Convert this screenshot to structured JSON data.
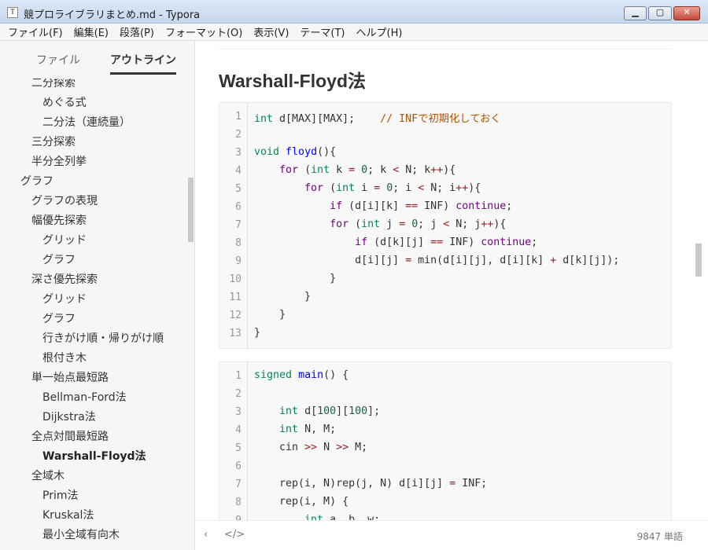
{
  "window": {
    "title": "競プロライブラリまとめ.md - Typora",
    "app_icon": "T"
  },
  "menu": [
    "ファイル(F)",
    "編集(E)",
    "段落(P)",
    "フォーマット(O)",
    "表示(V)",
    "テーマ(T)",
    "ヘルプ(H)"
  ],
  "sidebar": {
    "tabs": {
      "files": "ファイル",
      "outline": "アウトライン"
    },
    "outline": [
      {
        "label": "二分探索",
        "level": 2
      },
      {
        "label": "めぐる式",
        "level": 3
      },
      {
        "label": "二分法（連続量）",
        "level": 3
      },
      {
        "label": "三分探索",
        "level": 2
      },
      {
        "label": "半分全列挙",
        "level": 2
      },
      {
        "label": "グラフ",
        "level": 1
      },
      {
        "label": "グラフの表現",
        "level": 2
      },
      {
        "label": "幅優先探索",
        "level": 2
      },
      {
        "label": "グリッド",
        "level": 3
      },
      {
        "label": "グラフ",
        "level": 3
      },
      {
        "label": "深さ優先探索",
        "level": 2
      },
      {
        "label": "グリッド",
        "level": 3
      },
      {
        "label": "グラフ",
        "level": 3
      },
      {
        "label": "行きがけ順・帰りがけ順",
        "level": 3
      },
      {
        "label": "根付き木",
        "level": 3
      },
      {
        "label": "単一始点最短路",
        "level": 2
      },
      {
        "label": "Bellman-Ford法",
        "level": 3
      },
      {
        "label": "Dijkstra法",
        "level": 3
      },
      {
        "label": "全点対間最短路",
        "level": 2
      },
      {
        "label": "Warshall-Floyd法",
        "level": 3,
        "active": true
      },
      {
        "label": "全域木",
        "level": 2
      },
      {
        "label": "Prim法",
        "level": 3
      },
      {
        "label": "Kruskal法",
        "level": 3
      },
      {
        "label": "最小全域有向木",
        "level": 3
      }
    ]
  },
  "editor": {
    "heading": "Warshall-Floyd法",
    "code_blocks": [
      {
        "line_numbers": [
          "1",
          "2",
          "3",
          "4",
          "5",
          "6",
          "7",
          "8",
          "9",
          "10",
          "11",
          "12",
          "13"
        ],
        "lines": [
          [
            [
              "int",
              "ty"
            ],
            [
              " d[MAX][MAX];    ",
              ""
            ],
            [
              "// INFで初期化しておく",
              "cm"
            ]
          ],
          [],
          [
            [
              "void",
              "ty"
            ],
            [
              " ",
              ""
            ],
            [
              "floyd",
              "fn"
            ],
            [
              "(){",
              ""
            ]
          ],
          [
            [
              "    ",
              ""
            ],
            [
              "for",
              "kw"
            ],
            [
              " (",
              ""
            ],
            [
              "int",
              "ty"
            ],
            [
              " k ",
              ""
            ],
            [
              "=",
              "op"
            ],
            [
              " ",
              ""
            ],
            [
              "0",
              "num"
            ],
            [
              "; k ",
              ""
            ],
            [
              "<",
              "op"
            ],
            [
              " N; k",
              ""
            ],
            [
              "++",
              "op"
            ],
            [
              "){",
              ""
            ]
          ],
          [
            [
              "        ",
              ""
            ],
            [
              "for",
              "kw"
            ],
            [
              " (",
              ""
            ],
            [
              "int",
              "ty"
            ],
            [
              " i ",
              ""
            ],
            [
              "=",
              "op"
            ],
            [
              " ",
              ""
            ],
            [
              "0",
              "num"
            ],
            [
              "; i ",
              ""
            ],
            [
              "<",
              "op"
            ],
            [
              " N; i",
              ""
            ],
            [
              "++",
              "op"
            ],
            [
              "){",
              ""
            ]
          ],
          [
            [
              "            ",
              ""
            ],
            [
              "if",
              "kw"
            ],
            [
              " (d[i][k] ",
              ""
            ],
            [
              "==",
              "op"
            ],
            [
              " INF) ",
              ""
            ],
            [
              "continue",
              "kw"
            ],
            [
              ";",
              ""
            ]
          ],
          [
            [
              "            ",
              ""
            ],
            [
              "for",
              "kw"
            ],
            [
              " (",
              ""
            ],
            [
              "int",
              "ty"
            ],
            [
              " j ",
              ""
            ],
            [
              "=",
              "op"
            ],
            [
              " ",
              ""
            ],
            [
              "0",
              "num"
            ],
            [
              "; j ",
              ""
            ],
            [
              "<",
              "op"
            ],
            [
              " N; j",
              ""
            ],
            [
              "++",
              "op"
            ],
            [
              "){",
              ""
            ]
          ],
          [
            [
              "                ",
              ""
            ],
            [
              "if",
              "kw"
            ],
            [
              " (d[k][j] ",
              ""
            ],
            [
              "==",
              "op"
            ],
            [
              " INF) ",
              ""
            ],
            [
              "continue",
              "kw"
            ],
            [
              ";",
              ""
            ]
          ],
          [
            [
              "                d[i][j] ",
              ""
            ],
            [
              "=",
              "op"
            ],
            [
              " min(d[i][j], d[i][k] ",
              ""
            ],
            [
              "+",
              "op"
            ],
            [
              " d[k][j]);",
              ""
            ]
          ],
          [
            [
              "            }",
              ""
            ]
          ],
          [
            [
              "        }",
              ""
            ]
          ],
          [
            [
              "    }",
              ""
            ]
          ],
          [
            [
              "}",
              ""
            ]
          ]
        ]
      },
      {
        "line_numbers": [
          "1",
          "2",
          "3",
          "4",
          "5",
          "6",
          "7",
          "8",
          "9"
        ],
        "lines": [
          [
            [
              "signed",
              "ty"
            ],
            [
              " ",
              ""
            ],
            [
              "main",
              "fn"
            ],
            [
              "() {",
              ""
            ]
          ],
          [],
          [
            [
              "    ",
              ""
            ],
            [
              "int",
              "ty"
            ],
            [
              " d[",
              ""
            ],
            [
              "100",
              "num"
            ],
            [
              "][",
              ""
            ],
            [
              "100",
              "num"
            ],
            [
              "];",
              ""
            ]
          ],
          [
            [
              "    ",
              ""
            ],
            [
              "int",
              "ty"
            ],
            [
              " N, M;",
              ""
            ]
          ],
          [
            [
              "    cin ",
              ""
            ],
            [
              ">>",
              "op"
            ],
            [
              " N ",
              ""
            ],
            [
              ">>",
              "op"
            ],
            [
              " M;",
              ""
            ]
          ],
          [],
          [
            [
              "    rep(i, N)rep(j, N) d[i][j] ",
              ""
            ],
            [
              "=",
              "op"
            ],
            [
              " INF;",
              ""
            ]
          ],
          [
            [
              "    rep(i, M) {",
              ""
            ]
          ],
          [
            [
              "        ",
              ""
            ],
            [
              "int",
              "ty"
            ],
            [
              " a, b, w;",
              ""
            ]
          ]
        ]
      }
    ]
  },
  "status": {
    "back_icon": "‹",
    "source_icon": "</>",
    "word_count": "9847 単語"
  }
}
